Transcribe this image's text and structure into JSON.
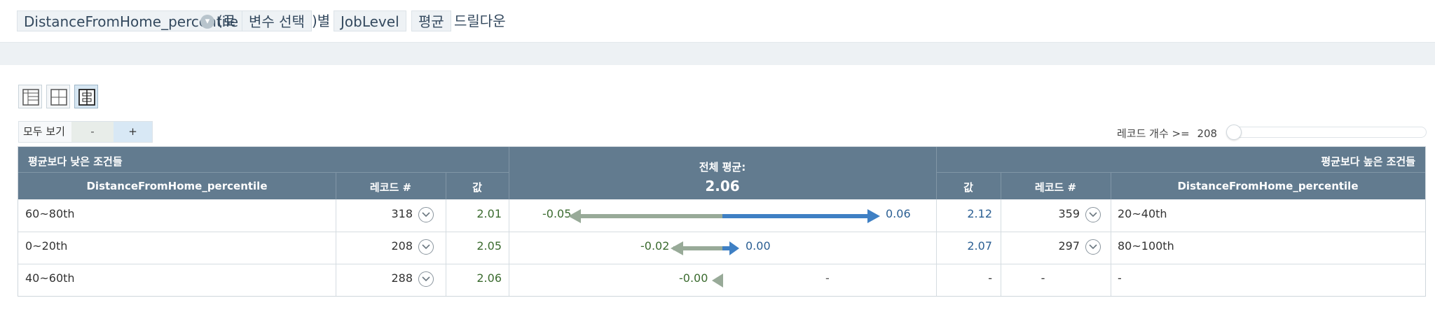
{
  "drilldown": {
    "field_chip": "DistanceFromHome_percentile",
    "open_paren_suffix": "(로",
    "select_chip": "변수 선택",
    "close_paren": ")별",
    "level_chip": "JobLevel",
    "agg_chip": "평균",
    "drilldown_label": "드릴다운",
    "dropdown_icon": "circle-chevron-icon"
  },
  "view_buttons": [
    {
      "name": "table-view",
      "icon": "table-icon",
      "active": false
    },
    {
      "name": "split-view",
      "icon": "grid-icon",
      "active": false
    },
    {
      "name": "bar-view",
      "icon": "bars-icon",
      "active": true
    }
  ],
  "controls": {
    "show_all_label": "모두 보기",
    "minus_label": "-",
    "plus_label": "+",
    "record_count_label": "레코드 개수 >=",
    "record_count_value": "208"
  },
  "table": {
    "lower_title": "평균보다 낮은 조건들",
    "higher_title": "평균보다 높은 조건들",
    "overall_label": "전체 평균:",
    "overall_value": "2.06",
    "columns": {
      "left_condition": "DistanceFromHome_percentile",
      "left_records": "레코드 #",
      "left_value": "값",
      "right_value": "값",
      "right_records": "레코드 #",
      "right_condition": "DistanceFromHome_percentile"
    },
    "rows": [
      {
        "left_condition": "60~80th",
        "left_records": "318",
        "left_value": "2.01",
        "diff_low": "-0.05",
        "diff_high": "0.06",
        "right_value": "2.12",
        "right_records": "359",
        "right_condition": "20~40th"
      },
      {
        "left_condition": "0~20th",
        "left_records": "208",
        "left_value": "2.05",
        "diff_low": "-0.02",
        "diff_high": "0.00",
        "right_value": "2.07",
        "right_records": "297",
        "right_condition": "80~100th"
      },
      {
        "left_condition": "40~60th",
        "left_records": "288",
        "left_value": "2.06",
        "diff_low": "-0.00",
        "diff_high": "-",
        "right_value": "-",
        "right_records": "-",
        "right_condition": "-"
      }
    ]
  },
  "colors": {
    "header_bg": "#627b8f",
    "low_bar": "#98aa98",
    "high_bar": "#3f80c4",
    "low_text": "#3b6b2f",
    "high_text": "#2b5f93"
  }
}
